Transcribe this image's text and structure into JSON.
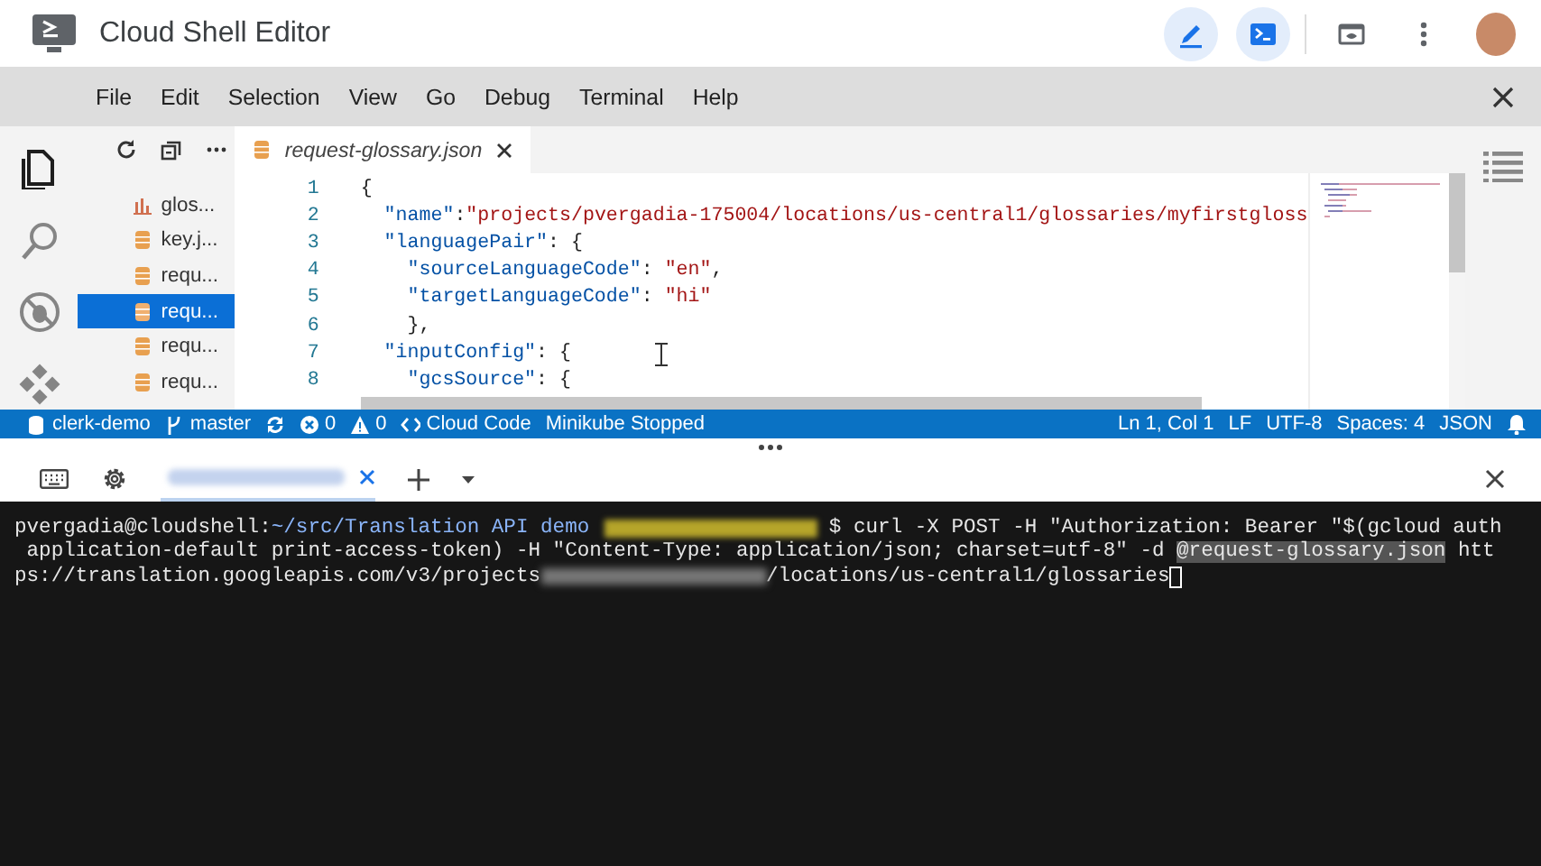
{
  "app_bar": {
    "title": "Cloud Shell Editor",
    "buttons": [
      {
        "kind": "pencil",
        "selected": true
      },
      {
        "kind": "terminal",
        "selected": true
      },
      {
        "kind": "preview",
        "selected": false
      },
      {
        "kind": "more",
        "selected": false
      }
    ]
  },
  "menu_bar": {
    "items": [
      "File",
      "Edit",
      "Selection",
      "View",
      "Go",
      "Debug",
      "Terminal",
      "Help"
    ]
  },
  "activity_bar": {
    "items": [
      {
        "kind": "files",
        "selected": true
      },
      {
        "kind": "search",
        "selected": false
      },
      {
        "kind": "debug",
        "selected": false
      },
      {
        "kind": "extensions",
        "selected": false
      }
    ]
  },
  "explorer": {
    "items": [
      {
        "label": "glos...",
        "kind": "chart",
        "selected": false
      },
      {
        "label": "key.j...",
        "kind": "json",
        "selected": false
      },
      {
        "label": "requ...",
        "kind": "json",
        "selected": false
      },
      {
        "label": "requ...",
        "kind": "json",
        "selected": true
      },
      {
        "label": "requ...",
        "kind": "json",
        "selected": false
      },
      {
        "label": "requ...",
        "kind": "json",
        "selected": false
      }
    ]
  },
  "editor": {
    "tabs": [
      {
        "label": "request-glossary.json",
        "selected": true
      }
    ],
    "lines": [
      {
        "number": "1",
        "tokens": [
          {
            "kind": "punct",
            "text": "{"
          }
        ]
      },
      {
        "number": "2",
        "tokens": [
          {
            "kind": "key",
            "text": "  \"name\""
          },
          {
            "kind": "punct",
            "text": ":"
          },
          {
            "kind": "string",
            "text": "\"projects/pvergadia-175004/locations/us-central1/glossaries/myfirstgloss"
          }
        ]
      },
      {
        "number": "3",
        "tokens": [
          {
            "kind": "key",
            "text": "  \"languagePair\""
          },
          {
            "kind": "punct",
            "text": ": {"
          }
        ]
      },
      {
        "number": "4",
        "tokens": [
          {
            "kind": "key",
            "text": "    \"sourceLanguageCode\""
          },
          {
            "kind": "punct",
            "text": ": "
          },
          {
            "kind": "string",
            "text": "\"en\""
          },
          {
            "kind": "punct",
            "text": ","
          }
        ]
      },
      {
        "number": "5",
        "tokens": [
          {
            "kind": "key",
            "text": "    \"targetLanguageCode\""
          },
          {
            "kind": "punct",
            "text": ": "
          },
          {
            "kind": "string",
            "text": "\"hi\""
          }
        ]
      },
      {
        "number": "6",
        "tokens": [
          {
            "kind": "punct",
            "text": "    },"
          }
        ]
      },
      {
        "number": "7",
        "tokens": [
          {
            "kind": "key",
            "text": "  \"inputConfig\""
          },
          {
            "kind": "punct",
            "text": ": {"
          }
        ]
      },
      {
        "number": "8",
        "tokens": [
          {
            "kind": "key",
            "text": "    \"gcsSource\""
          },
          {
            "kind": "punct",
            "text": ": {"
          }
        ]
      }
    ]
  },
  "status_bar": {
    "left": [
      {
        "kind": "database",
        "text": "clerk-demo"
      },
      {
        "kind": "branch",
        "text": "master"
      },
      {
        "kind": "sync"
      },
      {
        "kind": "errors",
        "text": "0"
      },
      {
        "kind": "warnings",
        "text": "0"
      },
      {
        "kind": "code",
        "text": "Cloud Code"
      },
      {
        "kind": "plain",
        "text": "Minikube Stopped"
      }
    ],
    "right": [
      "Ln 1, Col 1",
      "LF",
      "UTF-8",
      "Spaces: 4",
      "JSON"
    ]
  },
  "terminal": {
    "lines": [
      [
        {
          "kind": "prompt",
          "text": "pvergadia@cloudshell:"
        },
        {
          "kind": "path",
          "text": "~/src/Translation API demo "
        },
        {
          "kind": "blurred_project"
        },
        {
          "kind": "text",
          "text": "$ curl -X POST -H \"Authorization: Bearer \"$(gcloud auth"
        }
      ],
      [
        {
          "kind": "text",
          "text": " application-default print-access-token) -H \"Content-Type: application/json; charset=utf-8\" -d "
        },
        {
          "kind": "selection",
          "text": "@request-glossary.json"
        },
        {
          "kind": "text",
          "text": " htt"
        }
      ],
      [
        {
          "kind": "text",
          "text": "ps://translation.googleapis.com/v3/projects"
        },
        {
          "kind": "blurred"
        },
        {
          "kind": "text",
          "text": "/locations/us-central1/glossaries"
        },
        {
          "kind": "cursor"
        }
      ]
    ]
  }
}
